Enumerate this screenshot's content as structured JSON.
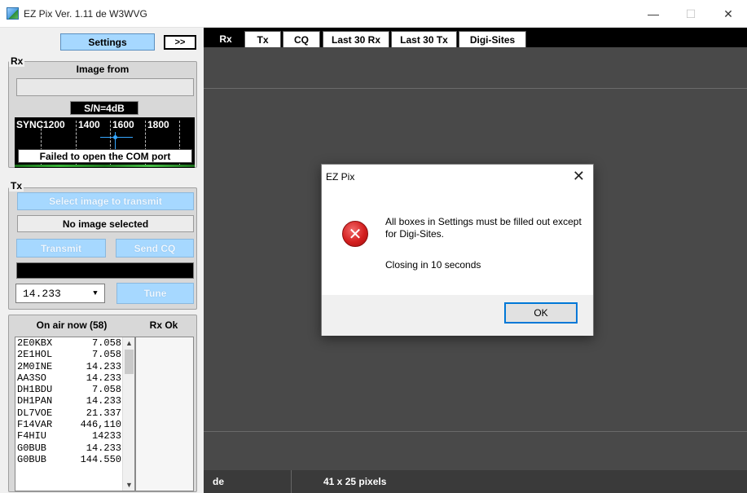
{
  "window": {
    "title": "EZ Pix   Ver. 1.11 de W3WVG",
    "minimize_glyph": "—",
    "maximize_glyph": "☐",
    "close_glyph": "✕"
  },
  "left": {
    "settings_label": "Settings",
    "expand_label": ">>",
    "rx": {
      "group_label": "Rx",
      "image_from": "Image from",
      "snr": "S/N=4dB",
      "spectrum": {
        "sync": "SYNC",
        "ticks": [
          "1200",
          "1400",
          "1600",
          "1800"
        ]
      },
      "error": "Failed to open the COM port"
    },
    "tx": {
      "group_label": "Tx",
      "select_image": "Select image to transmit",
      "no_image": "No image selected",
      "transmit": "Transmit",
      "send_cq": "Send CQ",
      "frequency": "14.233",
      "tune": "Tune"
    },
    "onair": {
      "header": "On air now (58)",
      "rxok_header": "Rx Ok",
      "rows": [
        {
          "call": "2E0KBX",
          "freq": "7.058"
        },
        {
          "call": "2E1HOL",
          "freq": "7.058"
        },
        {
          "call": "2M0INE",
          "freq": "14.233"
        },
        {
          "call": "AA3SO",
          "freq": "14.233"
        },
        {
          "call": "DH1BDU",
          "freq": "7.058"
        },
        {
          "call": "DH1PAN",
          "freq": "14.233"
        },
        {
          "call": "DL7VOE",
          "freq": "21.337"
        },
        {
          "call": "F14VAR",
          "freq": "446,110"
        },
        {
          "call": "F4HIU",
          "freq": "14233"
        },
        {
          "call": "G0BUB",
          "freq": "14.233"
        },
        {
          "call": "G0BUB",
          "freq": "144.550"
        }
      ]
    }
  },
  "tabs": [
    "Rx",
    "Tx",
    "CQ",
    "Last 30 Rx",
    "Last 30 Tx",
    "Digi-Sites"
  ],
  "status": {
    "de": "de",
    "size": "41 x 25 pixels"
  },
  "dialog": {
    "title": "EZ Pix",
    "close_glyph": "✕",
    "message": "All boxes in Settings must be filled out except for Digi-Sites.",
    "closing": "Closing in  10 seconds",
    "ok": "OK",
    "icon_glyph": "✕"
  },
  "colors": {
    "accent_blue": "#a6d8ff",
    "canvas_gray": "#494949",
    "error_red": "#d41f1f"
  }
}
